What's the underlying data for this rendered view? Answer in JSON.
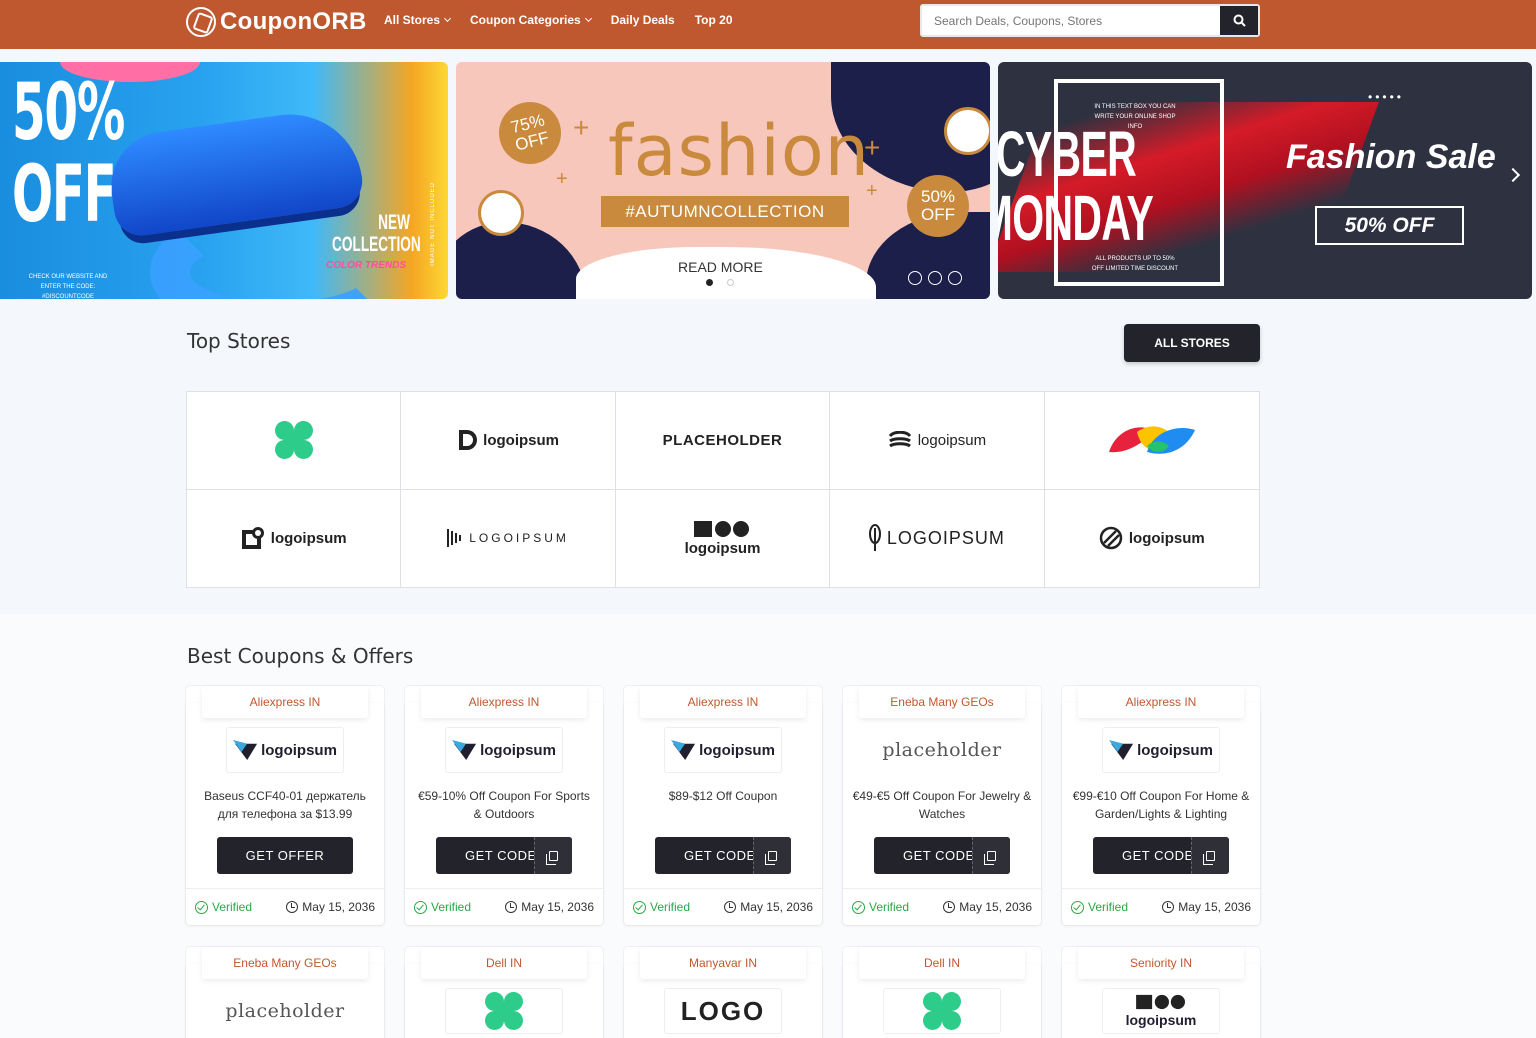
{
  "header": {
    "brand": "CouponORB",
    "nav": [
      {
        "label": "All Stores",
        "dropdown": true
      },
      {
        "label": "Coupon Categories",
        "dropdown": true
      },
      {
        "label": "Daily Deals",
        "dropdown": false
      },
      {
        "label": "Top 20",
        "dropdown": false
      }
    ],
    "search_placeholder": "Search Deals, Coupons, Stores",
    "accent": "#c0582f"
  },
  "banners": {
    "b1": {
      "big": "50% OFF",
      "new": "NEW COLLECTION",
      "trends": "COLOR TRENDS",
      "small": "CHECK OUR WEBSITE AND ENTER THE CODE: #DISCOUNTCODE",
      "vertical": "IMAGE NOT INCLUDED"
    },
    "b2": {
      "badge_left_1": "75%",
      "badge_left_2": "OFF",
      "title": "fashion",
      "tag": "#AUTUMNCOLLECTION",
      "badge_right_1": "50%",
      "badge_right_2": "OFF",
      "read_more": "READ MORE"
    },
    "b3": {
      "top_small": "IN THIS TEXT BOX YOU CAN WRITE YOUR ONLINE SHOP INFO",
      "cyber_1": "CYBER",
      "cyber_2": "MONDAY",
      "bottom_small": "ALL PRODUCTS UP TO 50% OFF LIMITED TIME DISCOUNT",
      "fashion_sale": "Fashion Sale",
      "off": "50% OFF"
    }
  },
  "top_stores": {
    "title": "Top Stores",
    "button": "ALL STORES",
    "logos": [
      {
        "icon": "clover-logo-icon",
        "text": ""
      },
      {
        "icon": "d-logo-icon",
        "text": "logoipsum"
      },
      {
        "icon": "",
        "text": "PLACEHOLDER"
      },
      {
        "icon": "waves-logo-icon",
        "text": "logoipsum"
      },
      {
        "icon": "color-petals-logo-icon",
        "text": ""
      },
      {
        "icon": "square-logo-icon",
        "text": "logoipsum"
      },
      {
        "icon": "bars-logo-icon",
        "text": "LOGOIPSUM"
      },
      {
        "icon": "shapes-logo-icon",
        "text": "logoipsum"
      },
      {
        "icon": "feather-logo-icon",
        "text": "LOGOIPSUM"
      },
      {
        "icon": "circle-slash-logo-icon",
        "text": "logoipsum"
      }
    ]
  },
  "coupons": {
    "title": "Best Coupons & Offers",
    "verified_label": "Verified",
    "items": [
      {
        "store": "Aliexpress IN",
        "logo": "logoipsum",
        "title": "Baseus CCF40-01 держатель для телефона за $13.99",
        "button": "GET OFFER",
        "type": "offer",
        "date": "May 15, 2036"
      },
      {
        "store": "Aliexpress IN",
        "logo": "logoipsum",
        "title": "€59-10% Off Coupon For Sports & Outdoors",
        "button": "GET CODE",
        "type": "code",
        "date": "May 15, 2036"
      },
      {
        "store": "Aliexpress IN",
        "logo": "logoipsum",
        "title": "$89-$12 Off Coupon",
        "button": "GET CODE",
        "type": "code",
        "date": "May 15, 2036"
      },
      {
        "store": "Eneba Many GEOs",
        "logo": "placeholder",
        "title": "€49-€5 Off Coupon For Jewelry & Watches",
        "button": "GET CODE",
        "type": "code",
        "date": "May 15, 2036"
      },
      {
        "store": "Aliexpress IN",
        "logo": "logoipsum",
        "title": "€99-€10 Off Coupon For Home & Garden/Lights & Lighting",
        "button": "GET CODE",
        "type": "code",
        "date": "May 15, 2036"
      }
    ],
    "row2": [
      {
        "store": "Eneba Many GEOs",
        "logo": "placeholder"
      },
      {
        "store": "Dell IN",
        "logo": ""
      },
      {
        "store": "Manyavar IN",
        "logo": "LOGO"
      },
      {
        "store": "Dell IN",
        "logo": ""
      },
      {
        "store": "Seniority IN",
        "logo": "logoipsum"
      }
    ]
  }
}
